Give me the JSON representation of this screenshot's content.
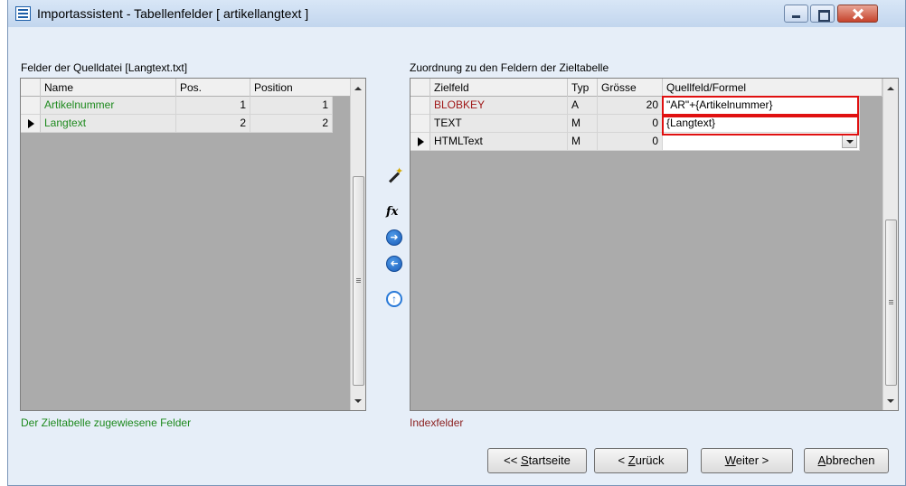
{
  "window": {
    "title": "Importassistent - Tabellenfelder [ artikellangtext ]"
  },
  "source": {
    "label": "Felder der Quelldatei [Langtext.txt]",
    "columns": [
      "Name",
      "Pos.",
      "Position"
    ],
    "rows": [
      {
        "name": "Artikelnummer",
        "pos": "1",
        "position": "1",
        "current": false
      },
      {
        "name": "Langtext",
        "pos": "2",
        "position": "2",
        "current": true
      }
    ],
    "legend": "Der Zieltabelle zugewiesene Felder"
  },
  "target": {
    "label": "Zuordnung zu den Feldern der Zieltabelle",
    "columns": [
      "Zielfeld",
      "Typ",
      "Grösse",
      "Quellfeld/Formel"
    ],
    "rows": [
      {
        "field": "BLOBKEY",
        "type": "A",
        "size": "20",
        "formula": "\"AR\"+{Artikelnummer}",
        "current": false
      },
      {
        "field": "TEXT",
        "type": "M",
        "size": "0",
        "formula": "{Langtext}",
        "current": false
      },
      {
        "field": "HTMLText",
        "type": "M",
        "size": "0",
        "formula": "",
        "current": true
      }
    ],
    "legend": "Indexfelder"
  },
  "toolbar": {
    "icons": [
      "wand-icon",
      "fx-icon",
      "arrow-right-icon",
      "arrow-left-icon",
      "arrow-up-icon"
    ],
    "fx_label": "fx"
  },
  "buttons": {
    "start": {
      "prefix": "<< ",
      "accel": "S",
      "rest": "tartseite"
    },
    "back": {
      "prefix": "< ",
      "accel": "Z",
      "rest": "urück"
    },
    "next": {
      "prefix": "",
      "accel": "W",
      "rest": "eiter >"
    },
    "cancel": {
      "prefix": "",
      "accel": "A",
      "rest": "bbrechen"
    }
  },
  "colors": {
    "assigned_green": "#1e8a1e",
    "index_red": "#a01818",
    "highlight_frame": "#e01010"
  }
}
